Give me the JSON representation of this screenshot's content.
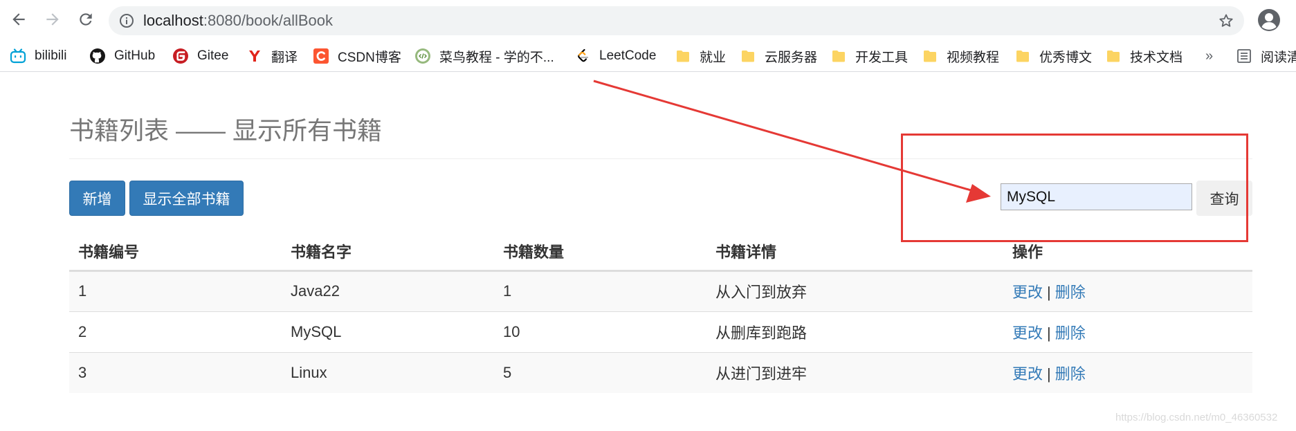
{
  "browser": {
    "url_host": "localhost",
    "url_rest": ":8080/book/allBook",
    "bookmarks": [
      {
        "label": "bilibili",
        "icon": "bilibili-icon"
      },
      {
        "label": "GitHub",
        "icon": "github-icon"
      },
      {
        "label": "Gitee",
        "icon": "gitee-icon"
      },
      {
        "label": "翻译",
        "icon": "youdao-icon"
      },
      {
        "label": "CSDN博客",
        "icon": "csdn-icon"
      },
      {
        "label": "菜鸟教程 - 学的不...",
        "icon": "runoob-icon"
      },
      {
        "label": "LeetCode",
        "icon": "leetcode-icon"
      },
      {
        "label": "就业",
        "icon": "folder-icon"
      },
      {
        "label": "云服务器",
        "icon": "folder-icon"
      },
      {
        "label": "开发工具",
        "icon": "folder-icon"
      },
      {
        "label": "视频教程",
        "icon": "folder-icon"
      },
      {
        "label": "优秀博文",
        "icon": "folder-icon"
      },
      {
        "label": "技术文档",
        "icon": "folder-icon"
      }
    ],
    "overflow": "»",
    "reading_list": "阅读清"
  },
  "page": {
    "title": "书籍列表 —— 显示所有书籍",
    "add_button": "新增",
    "show_all_button": "显示全部书籍",
    "search_value": "MySQL",
    "search_button": "查询"
  },
  "table": {
    "headers": [
      "书籍编号",
      "书籍名字",
      "书籍数量",
      "书籍详情",
      "操作"
    ],
    "rows": [
      {
        "id": "1",
        "name": "Java22",
        "count": "1",
        "detail": "从入门到放弃",
        "edit": "更改",
        "delete": "删除"
      },
      {
        "id": "2",
        "name": "MySQL",
        "count": "10",
        "detail": "从删库到跑路",
        "edit": "更改",
        "delete": "删除"
      },
      {
        "id": "3",
        "name": "Linux",
        "count": "5",
        "detail": "从进门到进牢",
        "edit": "更改",
        "delete": "删除"
      }
    ],
    "separator": "|"
  },
  "annotation": {
    "color": "#e53935"
  },
  "watermark": "https://blog.csdn.net/m0_46360532",
  "colors": {
    "primary": "#337ab7",
    "link": "#337ab7",
    "annotation": "#e53935"
  }
}
